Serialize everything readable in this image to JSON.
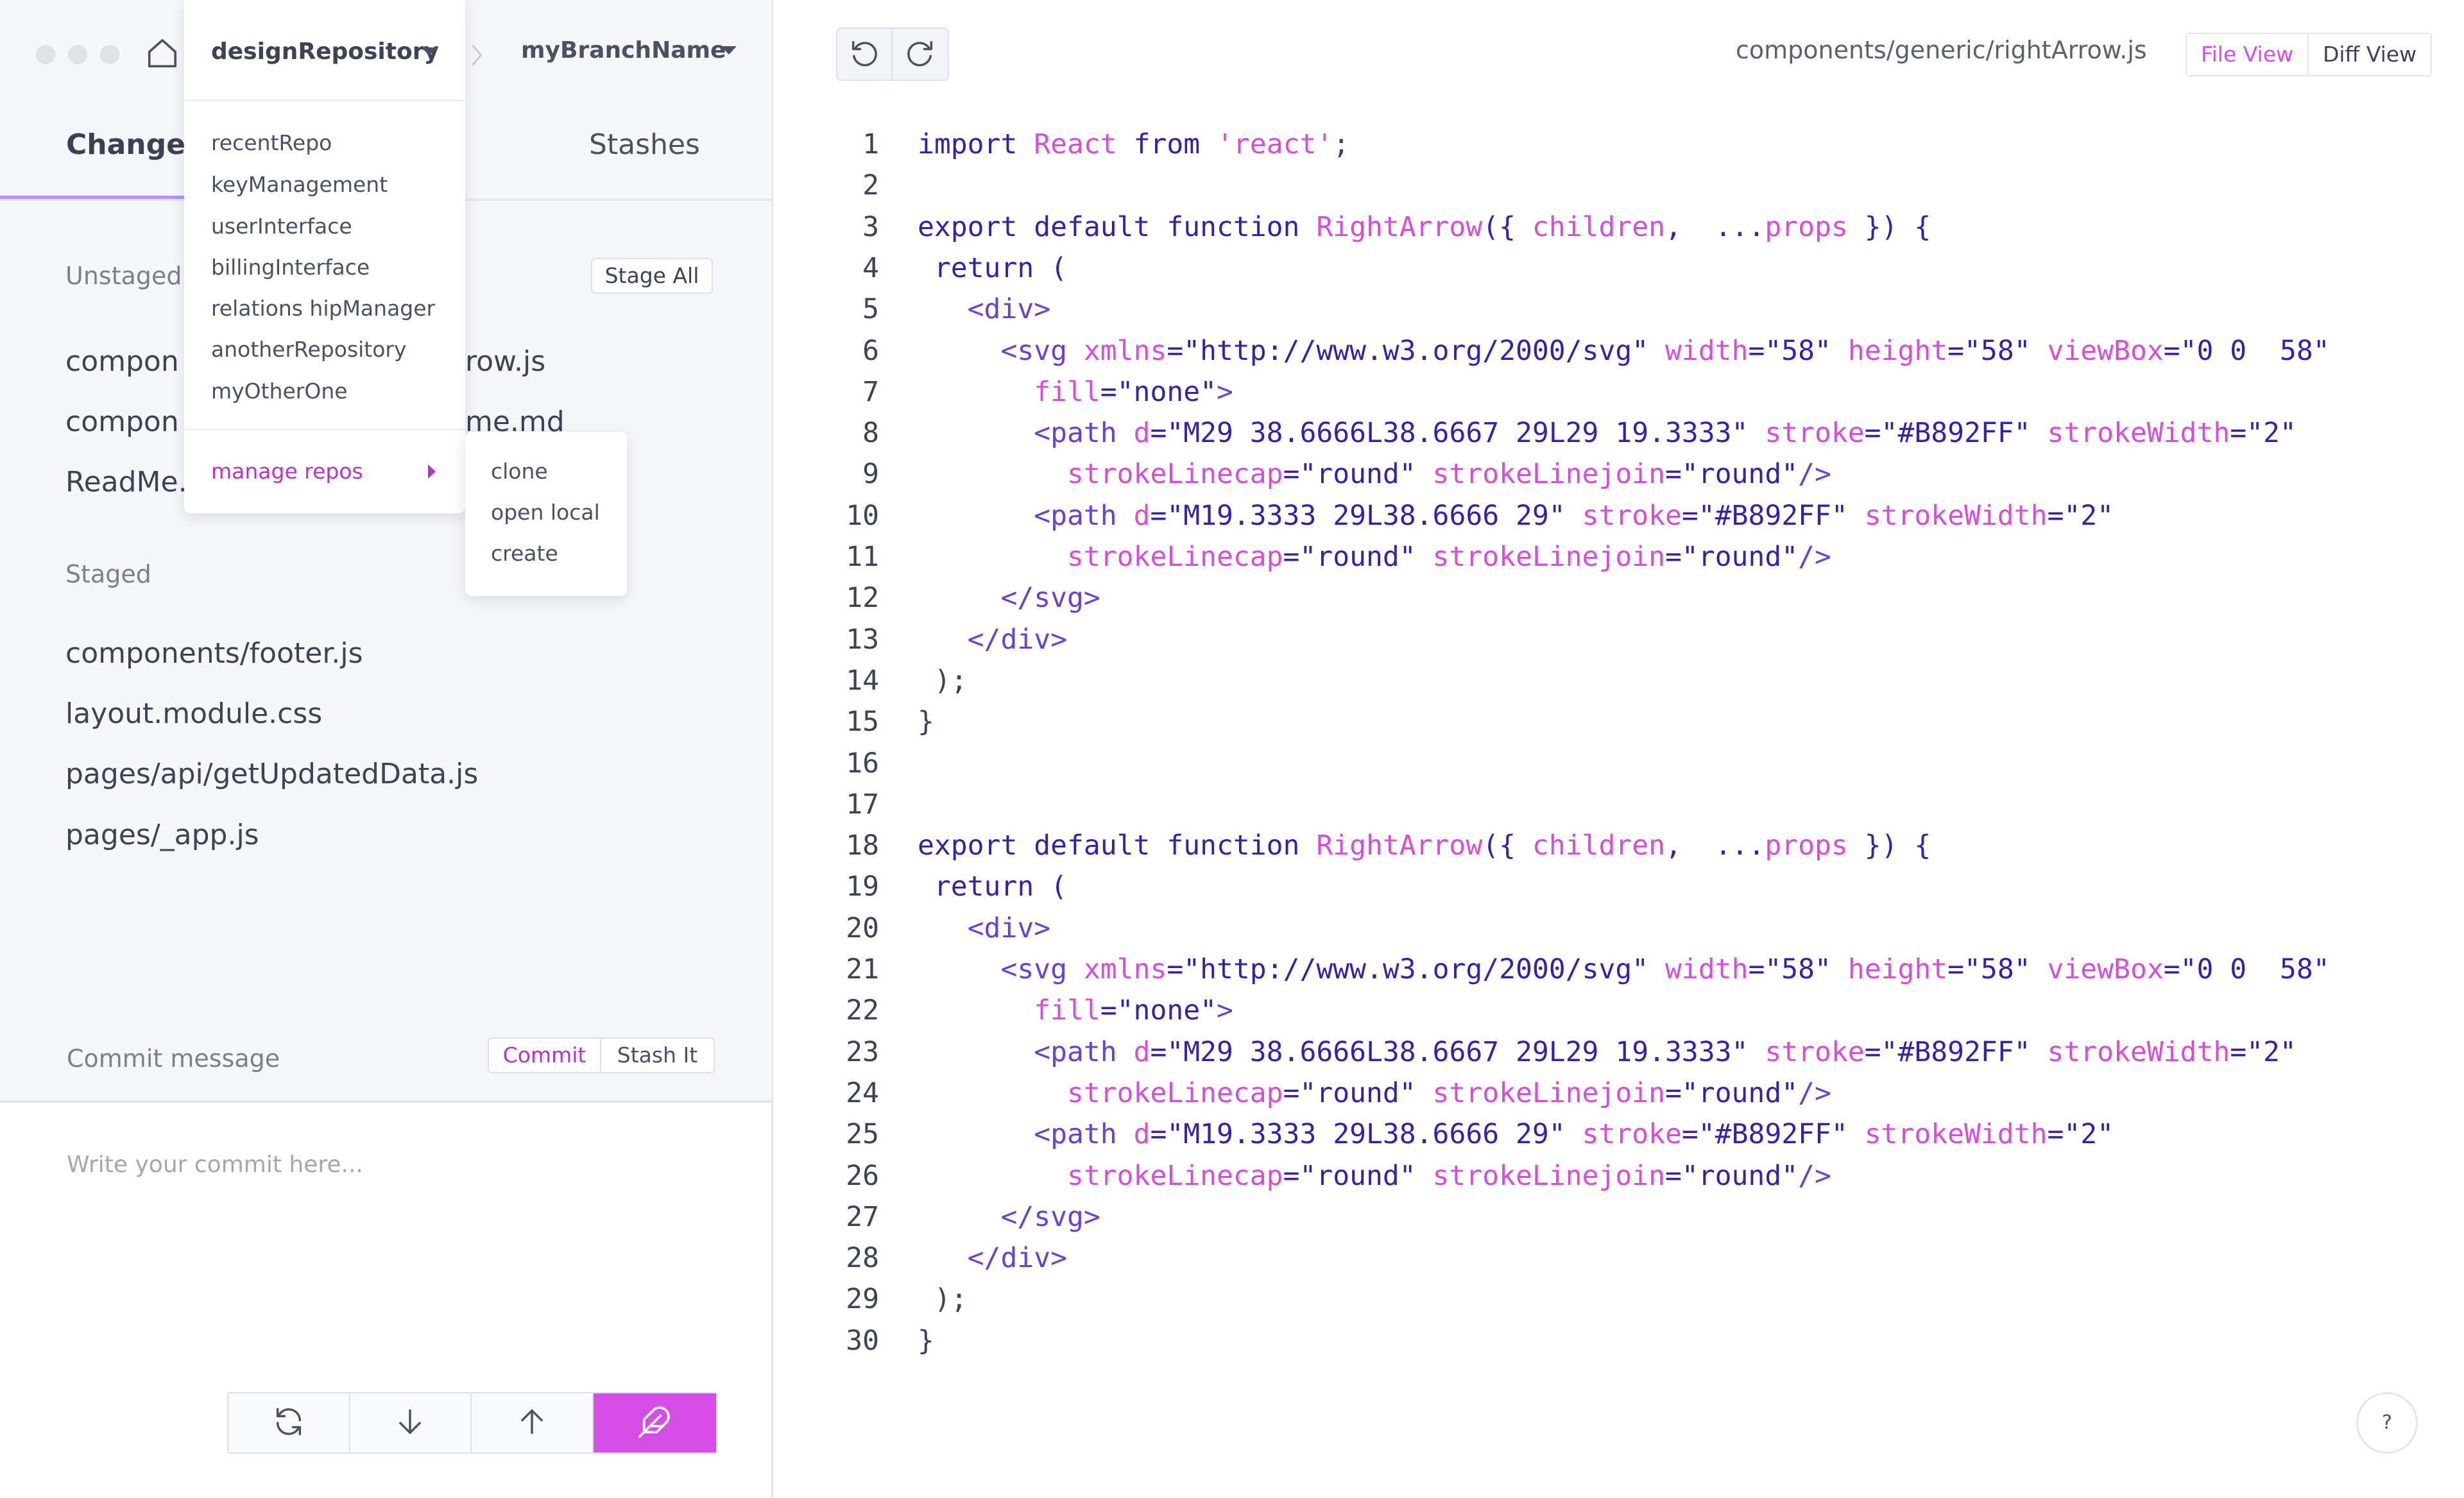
{
  "window": {
    "traffic_lights": [
      "close",
      "minimize",
      "maximize"
    ]
  },
  "header": {
    "repo_name": "designRepository",
    "branch_name": "myBranchName"
  },
  "repo_menu": {
    "items": [
      "recentRepo",
      "keyManagement",
      "userInterface",
      "billingInterface",
      "relations hipManager",
      "anotherRepository",
      "myOtherOne"
    ],
    "manage_label": "manage repos",
    "submenu": [
      "clone",
      "open local",
      "create"
    ]
  },
  "tabs": {
    "changes": "Changes",
    "stashes": "Stashes"
  },
  "unstaged": {
    "label": "Unstaged",
    "stage_all": "Stage All",
    "files": [
      "compon",
      "compon",
      "ReadMe."
    ],
    "file_tails": [
      "row.js",
      "me.md"
    ]
  },
  "staged": {
    "label": "Staged",
    "files": [
      "components/footer.js",
      "layout.module.css",
      "pages/api/getUpdatedData.js",
      "pages/_app.js"
    ]
  },
  "commit": {
    "label": "Commit message",
    "commit_button": "Commit",
    "stash_button": "Stash It",
    "placeholder": "Write your commit here..."
  },
  "action_bar": {
    "icons": [
      "sync-icon",
      "pull-icon",
      "push-icon",
      "feather-icon"
    ]
  },
  "editor": {
    "file_path": "components/generic/rightArrow.js",
    "file_view": "File View",
    "diff_view": "Diff View",
    "lines": [
      "1",
      "2",
      "3",
      "4",
      "5",
      "6",
      "7",
      "8",
      "9",
      "10",
      "11",
      "12",
      "13",
      "14",
      "15",
      "16",
      "17",
      "18",
      "19",
      "20",
      "21",
      "22",
      "23",
      "24",
      "25",
      "26",
      "27",
      "28",
      "29",
      "30"
    ]
  },
  "help": {
    "label": "?"
  },
  "colors": {
    "accent": "#d44de6",
    "accent_text": "#b832c8",
    "tab_underline": "#b892ff",
    "keyword": "#3a1ea8",
    "identifier": "#d64ed8"
  }
}
